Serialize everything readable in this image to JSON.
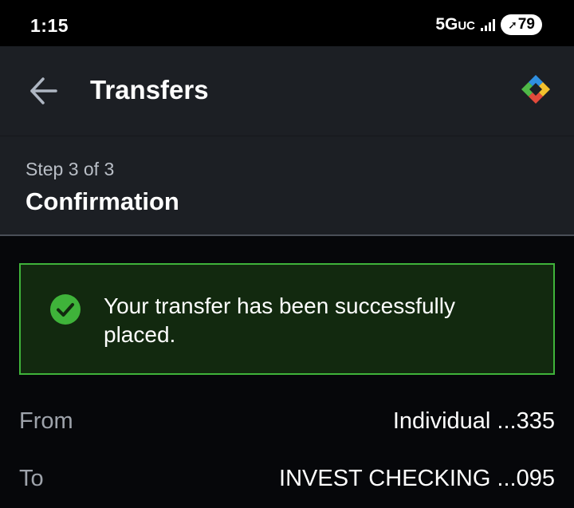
{
  "status_bar": {
    "time": "1:15",
    "network": "5G",
    "network_suffix": "UC",
    "battery": "79"
  },
  "app_bar": {
    "title": "Transfers",
    "back_icon": "arrow-back-icon",
    "logo_icon": "app-logo-icon"
  },
  "step": {
    "label": "Step 3 of  3",
    "title": "Confirmation"
  },
  "banner": {
    "message": "Your transfer has been successfully placed.",
    "icon": "check-circle-icon",
    "accent_color": "#3fb33a",
    "background_color": "#12290f"
  },
  "details": {
    "from": {
      "label": "From",
      "value": "Individual ...335"
    },
    "to": {
      "label": "To",
      "value": "INVEST CHECKING ...095"
    }
  }
}
